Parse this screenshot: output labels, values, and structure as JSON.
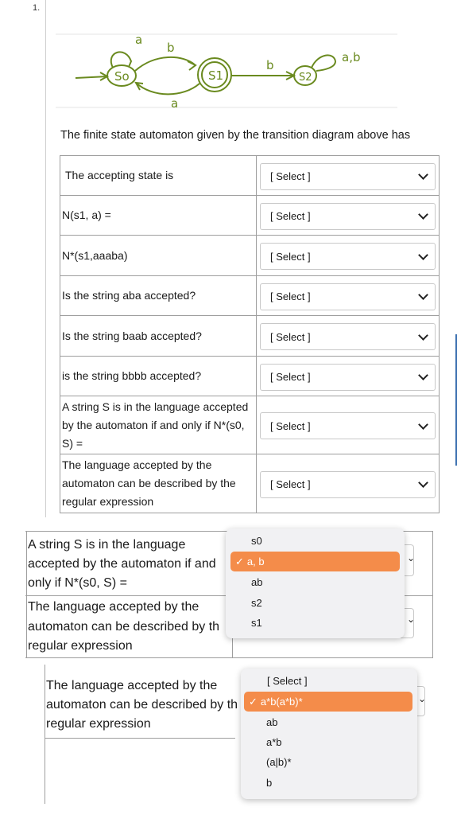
{
  "question_number": "1.",
  "diagram": {
    "states": [
      "So",
      "S1",
      "S2"
    ],
    "edge_labels": [
      "a",
      "b",
      "a",
      "b",
      "a,b"
    ]
  },
  "intro": "The finite state automaton given by the transition diagram above has",
  "questions": [
    {
      "prompt": "The accepting state is",
      "select": "[ Select ]"
    },
    {
      "prompt": "N(s1, a) =",
      "select": "[ Select ]"
    },
    {
      "prompt": "N*(s1,aaaba)",
      "select": "[ Select ]"
    },
    {
      "prompt": "Is the string aba accepted?",
      "select": "[ Select ]"
    },
    {
      "prompt": "Is the string baab accepted?",
      "select": "[ Select ]"
    },
    {
      "prompt": "is the string bbbb accepted?",
      "select": "[ Select ]"
    },
    {
      "prompt": "A string S is in the language accepted by the automaton if and only if N*(s0, S) =",
      "select": "[ Select ]"
    },
    {
      "prompt": "The language accepted by the automaton can be described by the regular expression",
      "select": "[ Select ]"
    }
  ],
  "zoom1": {
    "line1": "A string S is in the language",
    "line2": "accepted by the automaton if and",
    "line3": "only if N*(s0, S) =",
    "line4": "The language accepted by the",
    "line5": "automaton can be described by th",
    "line6": "regular expression",
    "options": [
      "s0",
      "a, b",
      "ab",
      "s2",
      "s1"
    ],
    "selected": "a, b"
  },
  "zoom2": {
    "line1": "The language accepted by the",
    "line2": "automaton can be described by th",
    "line3": "regular expression",
    "options": [
      "[ Select ]",
      "a*b(a*b)*",
      "ab",
      "a*b",
      "(a|b)*",
      "b"
    ],
    "selected": "a*b(a*b)*"
  },
  "colors": {
    "highlight": "#f48c4a",
    "diagram_stroke": "#6a8a1f"
  }
}
